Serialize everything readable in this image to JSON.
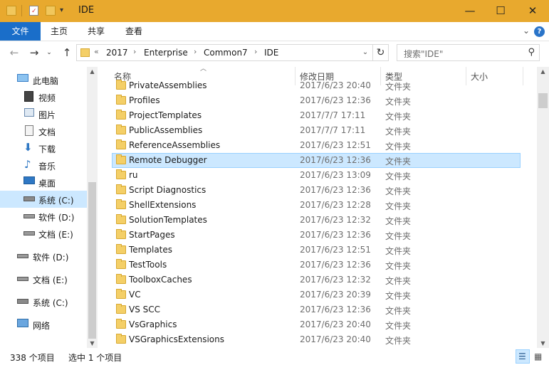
{
  "window": {
    "title": "IDE",
    "minimize_icon": "minimize-icon",
    "maximize_icon": "maximize-icon",
    "close_icon": "close-icon",
    "accent": "#e8a92e"
  },
  "ribbon": {
    "tabs": [
      {
        "label": "文件"
      },
      {
        "label": "主页"
      },
      {
        "label": "共享"
      },
      {
        "label": "查看"
      }
    ],
    "file_tab_color": "#1a6ec9"
  },
  "address": {
    "overflow": "«",
    "crumbs": [
      "2017",
      "Enterprise",
      "Common7",
      "IDE"
    ]
  },
  "search": {
    "placeholder": "搜索\"IDE\""
  },
  "nav": {
    "items": [
      {
        "label": "此电脑",
        "icon": "computer-icon"
      },
      {
        "label": "视频",
        "icon": "video-icon"
      },
      {
        "label": "图片",
        "icon": "pictures-icon"
      },
      {
        "label": "文档",
        "icon": "documents-icon"
      },
      {
        "label": "下载",
        "icon": "download-icon"
      },
      {
        "label": "音乐",
        "icon": "music-icon"
      },
      {
        "label": "桌面",
        "icon": "desktop-icon"
      },
      {
        "label": "系统 (C:)",
        "icon": "system-drive-icon"
      },
      {
        "label": "软件 (D:)",
        "icon": "drive-icon"
      },
      {
        "label": "文档 (E:)",
        "icon": "drive-icon"
      },
      {
        "label": "软件 (D:)",
        "icon": "drive-icon"
      },
      {
        "label": "文档 (E:)",
        "icon": "drive-icon"
      },
      {
        "label": "系统 (C:)",
        "icon": "system-drive-icon"
      },
      {
        "label": "网络",
        "icon": "network-icon"
      }
    ],
    "selected_index": 7
  },
  "list": {
    "columns": [
      "名称",
      "修改日期",
      "类型",
      "大小"
    ],
    "rows": [
      {
        "name": "PrivateAssemblies",
        "date": "2017/6/23 20:40",
        "type": "文件夹"
      },
      {
        "name": "Profiles",
        "date": "2017/6/23 12:36",
        "type": "文件夹"
      },
      {
        "name": "ProjectTemplates",
        "date": "2017/7/7 17:11",
        "type": "文件夹"
      },
      {
        "name": "PublicAssemblies",
        "date": "2017/7/7 17:11",
        "type": "文件夹"
      },
      {
        "name": "ReferenceAssemblies",
        "date": "2017/6/23 12:51",
        "type": "文件夹"
      },
      {
        "name": "Remote Debugger",
        "date": "2017/6/23 12:36",
        "type": "文件夹"
      },
      {
        "name": "ru",
        "date": "2017/6/23 13:09",
        "type": "文件夹"
      },
      {
        "name": "Script Diagnostics",
        "date": "2017/6/23 12:36",
        "type": "文件夹"
      },
      {
        "name": "ShellExtensions",
        "date": "2017/6/23 12:28",
        "type": "文件夹"
      },
      {
        "name": "SolutionTemplates",
        "date": "2017/6/23 12:32",
        "type": "文件夹"
      },
      {
        "name": "StartPages",
        "date": "2017/6/23 12:36",
        "type": "文件夹"
      },
      {
        "name": "Templates",
        "date": "2017/6/23 12:51",
        "type": "文件夹"
      },
      {
        "name": "TestTools",
        "date": "2017/6/23 12:36",
        "type": "文件夹"
      },
      {
        "name": "ToolboxCaches",
        "date": "2017/6/23 12:32",
        "type": "文件夹"
      },
      {
        "name": "VC",
        "date": "2017/6/23 20:39",
        "type": "文件夹"
      },
      {
        "name": "VS SCC",
        "date": "2017/6/23 12:36",
        "type": "文件夹"
      },
      {
        "name": "VsGraphics",
        "date": "2017/6/23 20:40",
        "type": "文件夹"
      },
      {
        "name": "VSGraphicsExtensions",
        "date": "2017/6/23 20:40",
        "type": "文件夹"
      }
    ],
    "selected_index": 5
  },
  "status": {
    "count": "338 个项目",
    "selection": "选中 1 个项目"
  }
}
